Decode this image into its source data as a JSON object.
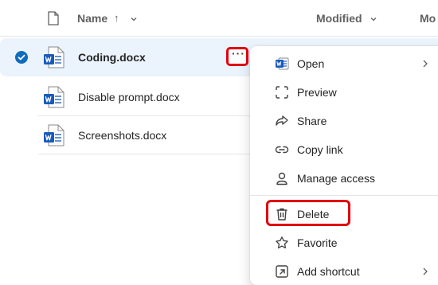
{
  "header": {
    "name_label": "Name",
    "sort_arrow": "↑",
    "modified_label": "Modified",
    "modified_by_partial": "Mo"
  },
  "files": [
    {
      "name": "Coding.docx",
      "selected": true
    },
    {
      "name": "Disable prompt.docx",
      "selected": false
    },
    {
      "name": "Screenshots.docx",
      "selected": false
    }
  ],
  "more_button": {
    "label": "···"
  },
  "context_menu": {
    "items": [
      {
        "label": "Open",
        "icon": "word-icon",
        "submenu": true
      },
      {
        "label": "Preview",
        "icon": "preview-icon"
      },
      {
        "label": "Share",
        "icon": "share-icon"
      },
      {
        "label": "Copy link",
        "icon": "link-icon"
      },
      {
        "label": "Manage access",
        "icon": "person-icon"
      },
      {
        "label": "Delete",
        "icon": "trash-icon"
      },
      {
        "label": "Favorite",
        "icon": "star-icon"
      },
      {
        "label": "Add shortcut",
        "icon": "shortcut-icon",
        "submenu": true
      }
    ]
  },
  "colors": {
    "accent": "#0f6cbd",
    "selected_row": "#ebf3fc",
    "highlight_red": "#e0000e",
    "word_blue": "#185abd"
  }
}
